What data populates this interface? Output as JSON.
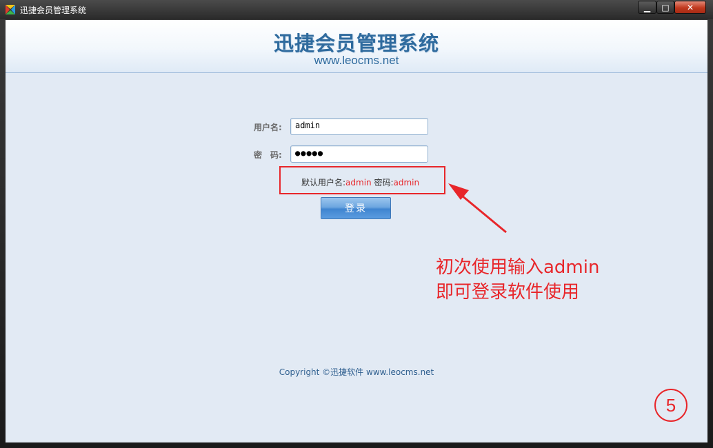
{
  "window": {
    "title": "迅捷会员管理系统",
    "minimize": "▁",
    "maximize": "□",
    "close": "✕"
  },
  "banner": {
    "title": "迅捷会员管理系统",
    "url": "www.leocms.net"
  },
  "login": {
    "username_label": "用户名:",
    "username_value": "admin",
    "password_label": "密　码:",
    "password_value": "●●●●●",
    "hint_prefix": "默认用户名:",
    "hint_user": "admin",
    "hint_mid": " 密码:",
    "hint_pass": "admin",
    "button_label": "登录"
  },
  "annotation": {
    "line1": "初次使用输入admin",
    "line2": "即可登录软件使用",
    "step_number": "5"
  },
  "footer": {
    "copyright": "Copyright ©迅捷软件  www.leocms.net"
  },
  "colors": {
    "accent_red": "#e8262a",
    "title_blue": "#2f6b9e",
    "background": "#e2eaf4"
  }
}
